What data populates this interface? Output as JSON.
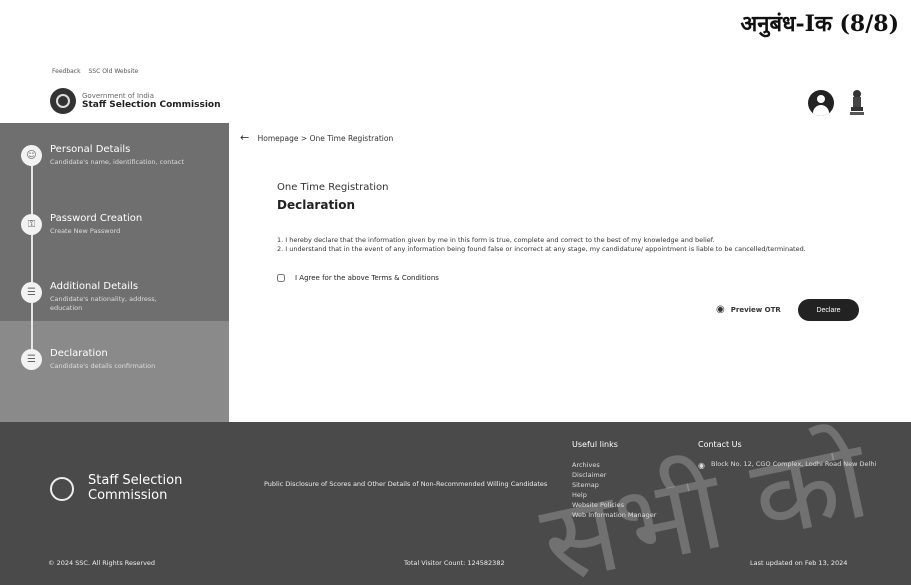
{
  "annexure": "अनुबंध-Iक (8/8)",
  "top_links": [
    "Feedback",
    "SSC Old Website"
  ],
  "header": {
    "gov": "Government of India",
    "org": "Staff Selection Commission"
  },
  "sidebar": {
    "steps": [
      {
        "title": "Personal Details",
        "sub": "Candidate's name, identification, contact",
        "icon": "person-icon"
      },
      {
        "title": "Password Creation",
        "sub": "Create New Password",
        "icon": "key-icon"
      },
      {
        "title": "Additional Details",
        "sub": "Candidate's nationality, address, education",
        "icon": "document-icon"
      },
      {
        "title": "Declaration",
        "sub": "Candidate's details confirmation",
        "icon": "document-check-icon"
      }
    ],
    "active_step": 3
  },
  "breadcrumb": {
    "home": "Homepage",
    "separator": ">",
    "current": "One Time Registration"
  },
  "form": {
    "title": "One Time Registration",
    "heading": "Declaration",
    "declarations": [
      "1. I hereby declare that the information given by me in this form is true, complete and correct to the best of my knowledge and belief.",
      "2. I understand that in the event of any information being found false or incorrect at any stage, my candidature/ appointment is liable to be cancelled/terminated."
    ],
    "agree_label": "I Agree for the above Terms & Conditions",
    "agree_checked": false,
    "preview_label": "Preview OTR",
    "declare_label": "Declare"
  },
  "footer": {
    "org": "Staff Selection Commission",
    "disclosure": "Public Disclosure of Scores and Other Details of Non-Recommended Willing Candidates",
    "useful_links_title": "Useful links",
    "useful_links": [
      "Archives",
      "Disclaimer",
      "Sitemap",
      "Help",
      "Website Policies",
      "Web Information Manager"
    ],
    "contact_title": "Contact Us",
    "contact_address": "Block No. 12, CGO Complex, Lodhi Road New Delhi",
    "copyright": "© 2024 SSC. All Rights Reserved",
    "visitor_count": "Total Visitor Count: 124582382",
    "last_updated": "Last updated on Feb 13, 2024",
    "watermark": "सभी को"
  }
}
